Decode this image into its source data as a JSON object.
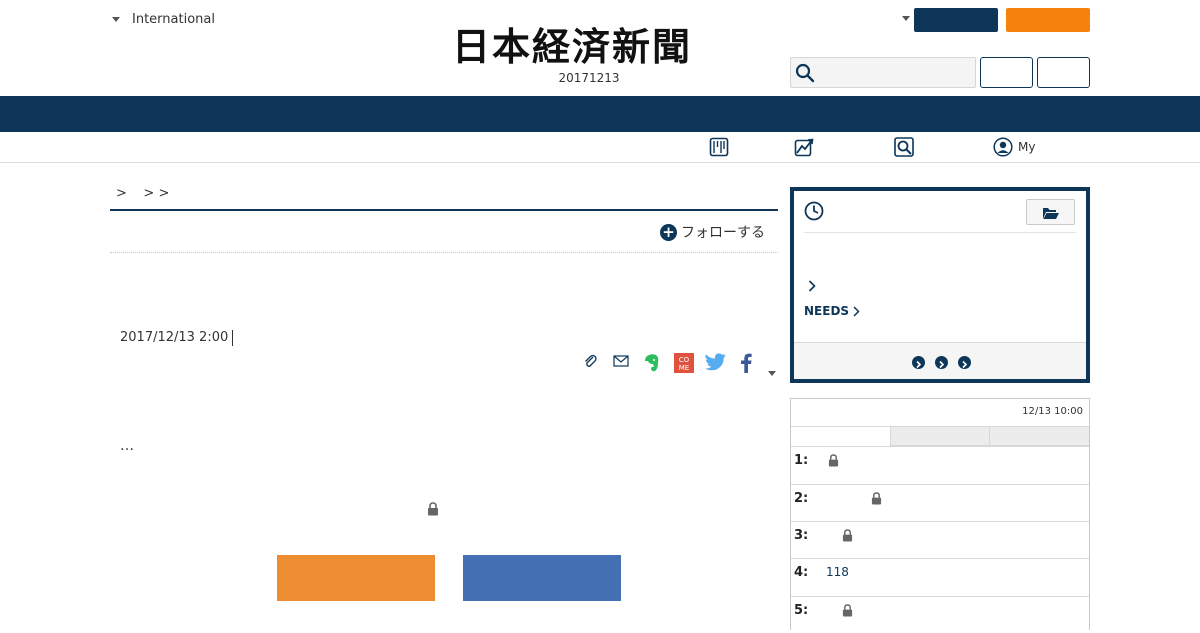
{
  "header": {
    "international_label": "International",
    "logo_text": "日本経済新聞",
    "edition_date": "20171213",
    "my_label": "My"
  },
  "colors": {
    "navy": "#0d3659",
    "orange": "#f6830e",
    "box_orange": "#ed8c31",
    "box_blue": "#456fb3"
  },
  "subnav": {
    "icons": [
      "paper-edition-icon",
      "market-chart-icon",
      "search-magnifier-icon",
      "user-avatar-icon"
    ]
  },
  "article": {
    "breadcrumb": ">    > >",
    "follow_label": "フォローする",
    "date": "2017/12/13 2:00",
    "ellipsis": "…",
    "share_icons": [
      "clip-icon",
      "mail-icon",
      "evernote-icon",
      "comemo-icon",
      "twitter-icon",
      "facebook-icon",
      "share-more-icon"
    ]
  },
  "sidebar": {
    "needs_label": "NEEDS",
    "ranking": {
      "timestamp": "12/13 10:00",
      "rows": [
        {
          "num": "1:",
          "value": "",
          "locked": true
        },
        {
          "num": "2:",
          "value": "",
          "locked": true
        },
        {
          "num": "3:",
          "value": "",
          "locked": true
        },
        {
          "num": "4:",
          "value": "118",
          "locked": false
        },
        {
          "num": "5:",
          "value": "",
          "locked": true
        }
      ]
    }
  }
}
